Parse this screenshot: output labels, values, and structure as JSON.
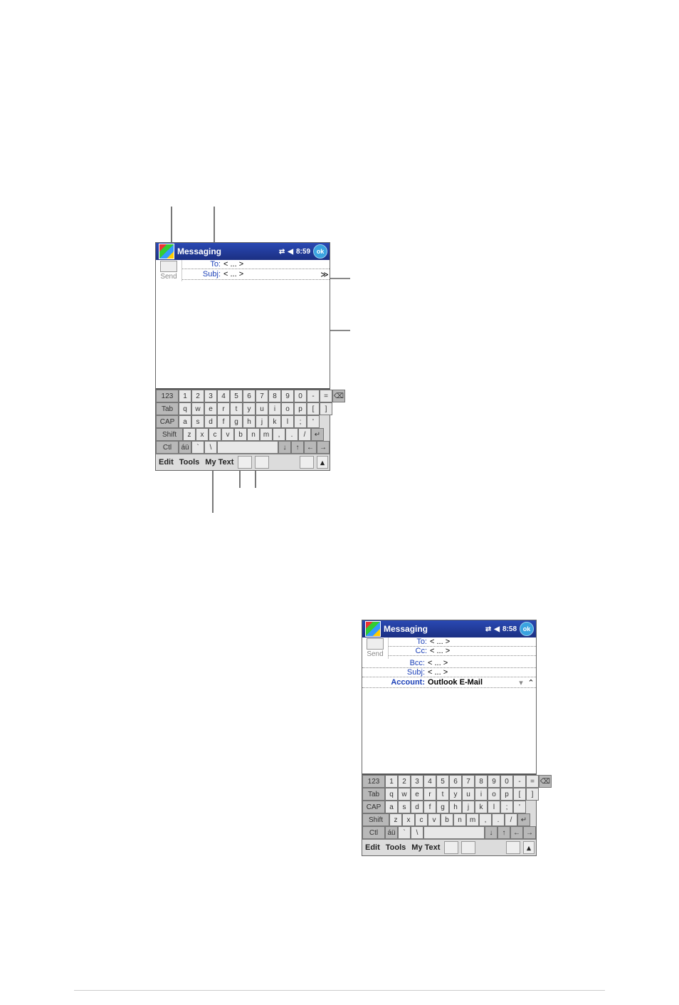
{
  "device1": {
    "title": "Messaging",
    "time": "8:59",
    "ok": "ok",
    "send": "Send",
    "to_label": "To:",
    "to_value": "< ... >",
    "subj_label": "Subj:",
    "subj_value": "< ... >",
    "menu": {
      "edit": "Edit",
      "tools": "Tools",
      "mytext": "My Text"
    }
  },
  "device2": {
    "title": "Messaging",
    "time": "8:58",
    "ok": "ok",
    "send": "Send",
    "to_label": "To:",
    "to_value": "< ... >",
    "cc_label": "Cc:",
    "cc_value": "< ... >",
    "bcc_label": "Bcc:",
    "bcc_value": "< ... >",
    "subj_label": "Subj:",
    "subj_value": "< ... >",
    "acct_label": "Account:",
    "acct_value": "Outlook E-Mail",
    "menu": {
      "edit": "Edit",
      "tools": "Tools",
      "mytext": "My Text"
    }
  },
  "keyboard": {
    "row0": [
      "123",
      "1",
      "2",
      "3",
      "4",
      "5",
      "6",
      "7",
      "8",
      "9",
      "0",
      "-",
      "=",
      "⌫"
    ],
    "row1": [
      "Tab",
      "q",
      "w",
      "e",
      "r",
      "t",
      "y",
      "u",
      "i",
      "o",
      "p",
      "[",
      "]"
    ],
    "row2": [
      "CAP",
      "a",
      "s",
      "d",
      "f",
      "g",
      "h",
      "j",
      "k",
      "l",
      ";",
      "'"
    ],
    "row3": [
      "Shift",
      "z",
      "x",
      "c",
      "v",
      "b",
      "n",
      "m",
      ",",
      ".",
      "/",
      "↵"
    ],
    "row4": [
      "Ctl",
      "áü",
      "`",
      "\\",
      " ",
      "↓",
      "↑",
      "←",
      "→"
    ]
  },
  "icons": {
    "conn": "⇄",
    "speaker": "◀",
    "collapse": "▾",
    "expand_chev": "≫"
  }
}
